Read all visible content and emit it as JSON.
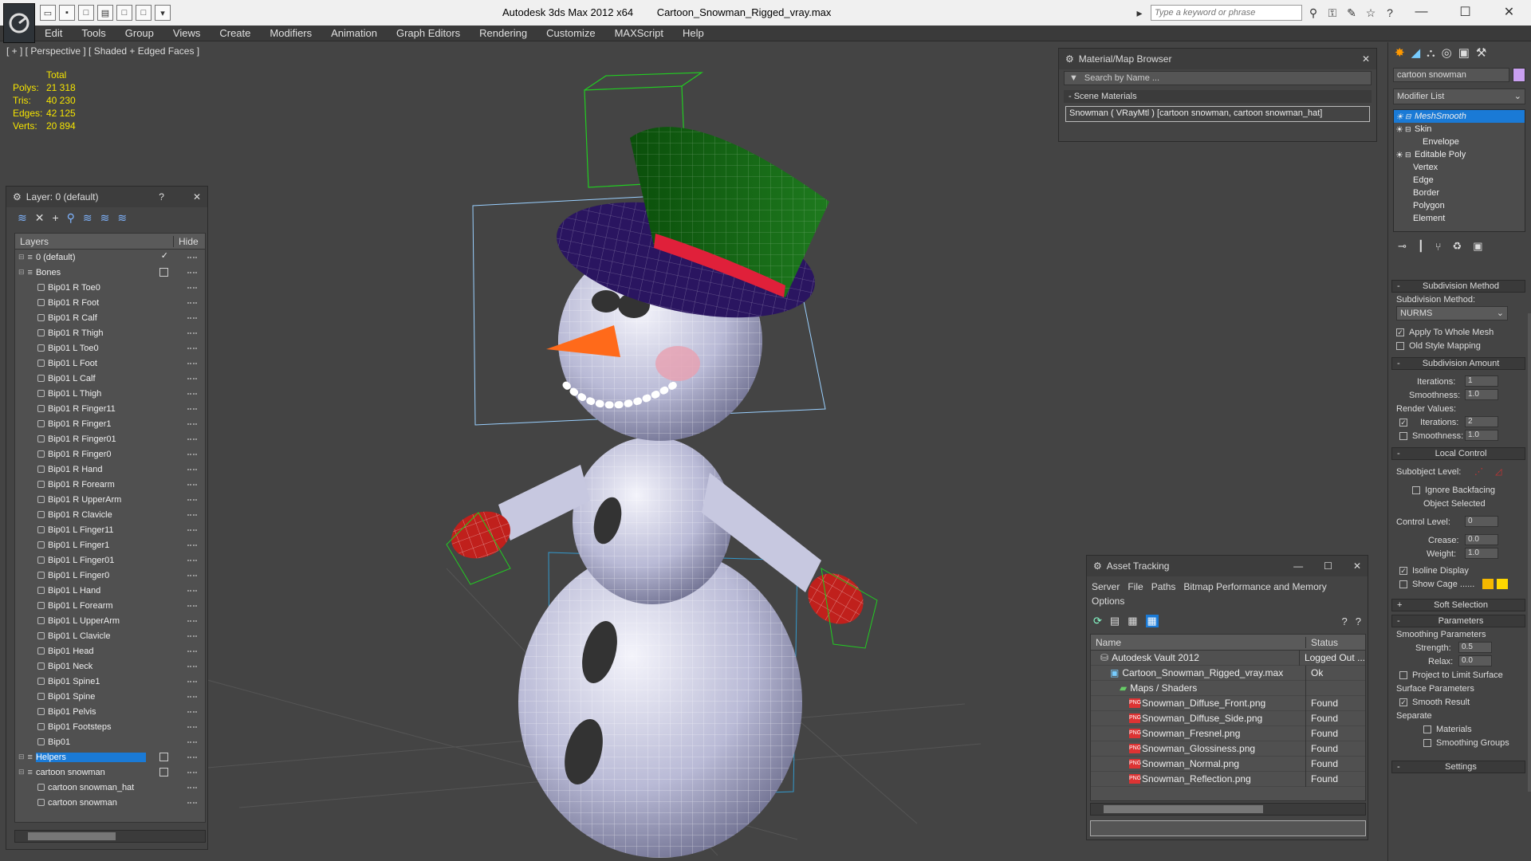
{
  "window": {
    "app_title": "Autodesk 3ds Max  2012 x64",
    "file_title": "Cartoon_Snowman_Rigged_vray.max",
    "search_placeholder": "Type a keyword or phrase"
  },
  "menu": [
    "Edit",
    "Tools",
    "Group",
    "Views",
    "Create",
    "Modifiers",
    "Animation",
    "Graph Editors",
    "Rendering",
    "Customize",
    "MAXScript",
    "Help"
  ],
  "viewport": {
    "label": "[ + ] [ Perspective ] [ Shaded + Edged Faces ]",
    "stats_header": "Total",
    "stats": [
      {
        "label": "Polys:",
        "value": "21 318"
      },
      {
        "label": "Tris:",
        "value": "40 230"
      },
      {
        "label": "Edges:",
        "value": "42 125"
      },
      {
        "label": "Verts:",
        "value": "20 894"
      }
    ]
  },
  "layer_panel": {
    "title": "Layer: 0 (default)",
    "help": "?",
    "col_layers": "Layers",
    "col_hide": "Hide",
    "rows": [
      {
        "name": "0 (default)",
        "kind": "layer",
        "check": true
      },
      {
        "name": "Bones",
        "kind": "layer",
        "box": true
      },
      {
        "name": "Bip01 R Toe0",
        "kind": "obj"
      },
      {
        "name": "Bip01 R Foot",
        "kind": "obj"
      },
      {
        "name": "Bip01 R Calf",
        "kind": "obj"
      },
      {
        "name": "Bip01 R Thigh",
        "kind": "obj"
      },
      {
        "name": "Bip01 L Toe0",
        "kind": "obj"
      },
      {
        "name": "Bip01 L Foot",
        "kind": "obj"
      },
      {
        "name": "Bip01 L Calf",
        "kind": "obj"
      },
      {
        "name": "Bip01 L Thigh",
        "kind": "obj"
      },
      {
        "name": "Bip01 R Finger11",
        "kind": "obj"
      },
      {
        "name": "Bip01 R Finger1",
        "kind": "obj"
      },
      {
        "name": "Bip01 R Finger01",
        "kind": "obj"
      },
      {
        "name": "Bip01 R Finger0",
        "kind": "obj"
      },
      {
        "name": "Bip01 R Hand",
        "kind": "obj"
      },
      {
        "name": "Bip01 R Forearm",
        "kind": "obj"
      },
      {
        "name": "Bip01 R UpperArm",
        "kind": "obj"
      },
      {
        "name": "Bip01 R Clavicle",
        "kind": "obj"
      },
      {
        "name": "Bip01 L Finger11",
        "kind": "obj"
      },
      {
        "name": "Bip01 L Finger1",
        "kind": "obj"
      },
      {
        "name": "Bip01 L Finger01",
        "kind": "obj"
      },
      {
        "name": "Bip01 L Finger0",
        "kind": "obj"
      },
      {
        "name": "Bip01 L Hand",
        "kind": "obj"
      },
      {
        "name": "Bip01 L Forearm",
        "kind": "obj"
      },
      {
        "name": "Bip01 L UpperArm",
        "kind": "obj"
      },
      {
        "name": "Bip01 L Clavicle",
        "kind": "obj"
      },
      {
        "name": "Bip01 Head",
        "kind": "obj"
      },
      {
        "name": "Bip01 Neck",
        "kind": "obj"
      },
      {
        "name": "Bip01 Spine1",
        "kind": "obj"
      },
      {
        "name": "Bip01 Spine",
        "kind": "obj"
      },
      {
        "name": "Bip01 Pelvis",
        "kind": "obj"
      },
      {
        "name": "Bip01 Footsteps",
        "kind": "obj"
      },
      {
        "name": "Bip01",
        "kind": "obj"
      },
      {
        "name": "Helpers",
        "kind": "layer",
        "box": true,
        "selected": true
      },
      {
        "name": "cartoon snowman",
        "kind": "layer",
        "box": true
      },
      {
        "name": "cartoon snowman_hat",
        "kind": "obj"
      },
      {
        "name": "cartoon snowman",
        "kind": "obj"
      }
    ]
  },
  "material_browser": {
    "title": "Material/Map Browser",
    "search_placeholder": "Search by Name ...",
    "section": "- Scene Materials",
    "item": "Snowman  ( VRayMtl ) [cartoon snowman, cartoon snowman_hat]"
  },
  "asset_tracking": {
    "title": "Asset Tracking",
    "menu": [
      "Server",
      "File",
      "Paths",
      "Bitmap Performance and Memory"
    ],
    "menu2": "Options",
    "col_name": "Name",
    "col_status": "Status",
    "rows": [
      {
        "name": "Autodesk Vault 2012",
        "status": "Logged Out ...",
        "indent": 1,
        "icon": "vault"
      },
      {
        "name": "Cartoon_Snowman_Rigged_vray.max",
        "status": "Ok",
        "indent": 2,
        "icon": "max"
      },
      {
        "name": "Maps / Shaders",
        "status": "",
        "indent": 3,
        "icon": "maps"
      },
      {
        "name": "Snowman_Diffuse_Front.png",
        "status": "Found",
        "indent": 4,
        "icon": "png"
      },
      {
        "name": "Snowman_Diffuse_Side.png",
        "status": "Found",
        "indent": 4,
        "icon": "png"
      },
      {
        "name": "Snowman_Fresnel.png",
        "status": "Found",
        "indent": 4,
        "icon": "png"
      },
      {
        "name": "Snowman_Glossiness.png",
        "status": "Found",
        "indent": 4,
        "icon": "png"
      },
      {
        "name": "Snowman_Normal.png",
        "status": "Found",
        "indent": 4,
        "icon": "png"
      },
      {
        "name": "Snowman_Reflection.png",
        "status": "Found",
        "indent": 4,
        "icon": "png"
      }
    ]
  },
  "command_panel": {
    "object_name": "cartoon snowman",
    "modifier_list": "Modifier List",
    "stack": [
      {
        "name": "MeshSmooth",
        "indent": 0,
        "selected": true
      },
      {
        "name": "Skin",
        "indent": 0
      },
      {
        "name": "Envelope",
        "indent": 2
      },
      {
        "name": "Editable Poly",
        "indent": 0
      },
      {
        "name": "Vertex",
        "indent": 1
      },
      {
        "name": "Edge",
        "indent": 1
      },
      {
        "name": "Border",
        "indent": 1
      },
      {
        "name": "Polygon",
        "indent": 1
      },
      {
        "name": "Element",
        "indent": 1
      }
    ],
    "subdivision_method": {
      "title": "Subdivision Method",
      "label": "Subdivision Method:",
      "value": "NURMS",
      "apply_whole": "Apply To Whole Mesh",
      "old_style": "Old Style Mapping"
    },
    "subdivision_amount": {
      "title": "Subdivision Amount",
      "iterations_label": "Iterations:",
      "iterations": "1",
      "smoothness_label": "Smoothness:",
      "smoothness": "1.0",
      "render_values": "Render Values:",
      "r_iterations": "2",
      "r_smoothness": "1.0"
    },
    "local_control": {
      "title": "Local Control",
      "subobject": "Subobject Level:",
      "ignore_backfacing": "Ignore Backfacing",
      "object_selected": "Object Selected",
      "control_level": "Control Level:",
      "control_level_val": "0",
      "crease": "Crease:",
      "crease_val": "0.0",
      "weight": "Weight:",
      "weight_val": "1.0",
      "isoline": "Isoline Display",
      "show_cage": "Show Cage ......"
    },
    "soft_selection": "Soft Selection",
    "parameters": {
      "title": "Parameters",
      "smoothing": "Smoothing Parameters",
      "strength": "Strength:",
      "strength_val": "0.5",
      "relax": "Relax:",
      "relax_val": "0.0",
      "project": "Project to Limit Surface",
      "surface": "Surface Parameters",
      "smooth_result": "Smooth Result",
      "separate": "Separate",
      "materials": "Materials",
      "smoothing_groups": "Smoothing Groups"
    },
    "settings": "Settings"
  }
}
